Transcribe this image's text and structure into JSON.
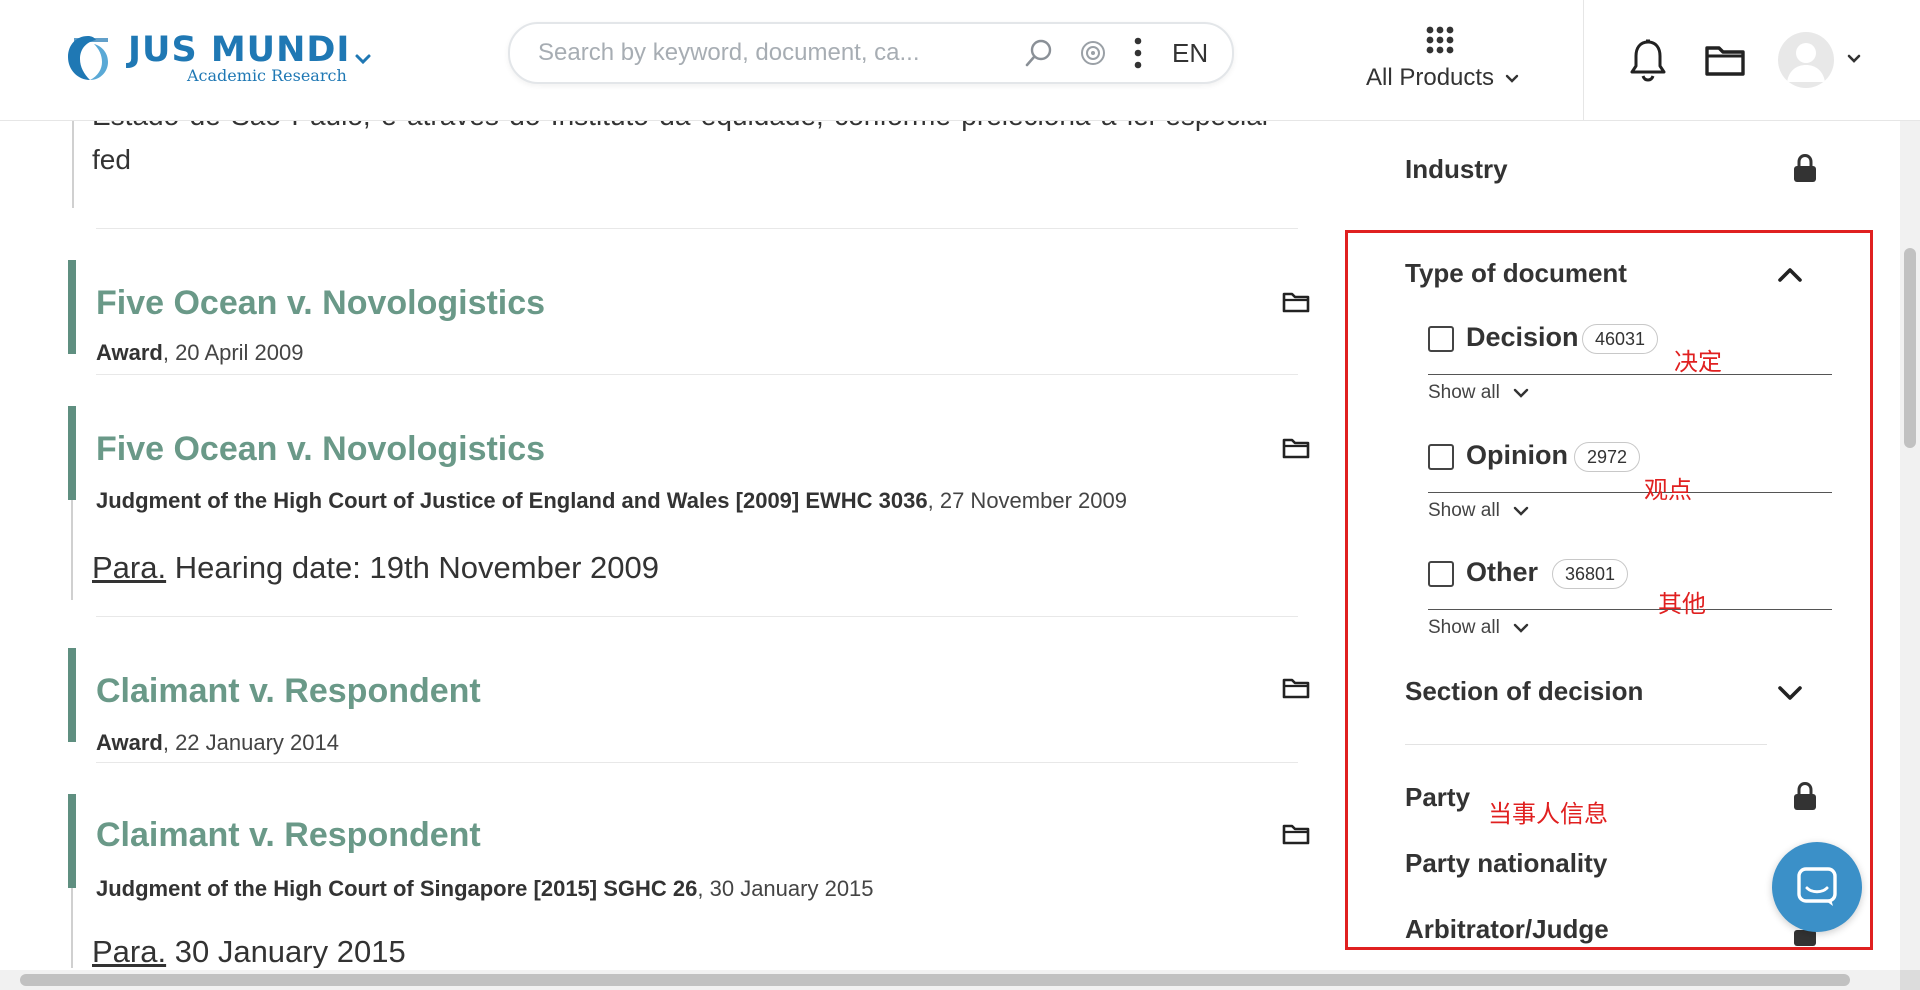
{
  "header": {
    "logo_title": "JUS MUNDI",
    "logo_subtitle": "Academic Research",
    "search_placeholder": "Search by keyword, document, ca...",
    "language": "EN",
    "products_label": "All Products"
  },
  "results": {
    "previous_text": "Estado de São Paulo, é através do Instituto da equidade, conforme preleciona a lei especial fed",
    "items": [
      {
        "title": "Five Ocean v. Novologistics",
        "doc_type": "Award",
        "date": ", 20 April 2009"
      },
      {
        "title": "Five Ocean v. Novologistics",
        "doc_type": "Judgment of the High Court of Justice of England and Wales [2009] EWHC 3036",
        "date": ", 27 November 2009",
        "para_label": "Para.",
        "para_text": "Hearing date: 19th November 2009"
      },
      {
        "title": "Claimant v. Respondent",
        "doc_type": "Award",
        "date": ", 22 January 2014"
      },
      {
        "title": "Claimant v. Respondent",
        "doc_type": "Judgment of the High Court of Singapore [2015] SGHC 26",
        "date": ", 30 January 2015",
        "para_label": "Para.",
        "para_text": "30 January 2015"
      }
    ]
  },
  "filters": {
    "industry": "Industry",
    "type_of_document": "Type of document",
    "options": [
      {
        "label": "Decision",
        "count": "46031",
        "annotation": "决定"
      },
      {
        "label": "Opinion",
        "count": "2972",
        "annotation": "观点"
      },
      {
        "label": "Other",
        "count": "36801",
        "annotation": "其他"
      }
    ],
    "show_all": "Show all",
    "section_of_decision": "Section of decision",
    "party": "Party",
    "party_annotation": "当事人信息",
    "party_nationality": "Party nationality",
    "arbitrator_judge": "Arbitrator/Judge"
  },
  "colors": {
    "brand_blue": "#1f78b4",
    "result_title": "#6a9988",
    "result_bar": "#5f8f80",
    "annotation_red": "#e02020",
    "chat_button": "#3b90c8"
  },
  "icons": [
    "logo-mark",
    "chevron-down-icon",
    "search-icon",
    "target-icon",
    "more-vertical-icon",
    "grid-icon",
    "bell-icon",
    "folder-icon",
    "avatar-icon",
    "lock-icon",
    "chevron-up-icon",
    "chat-icon"
  ]
}
